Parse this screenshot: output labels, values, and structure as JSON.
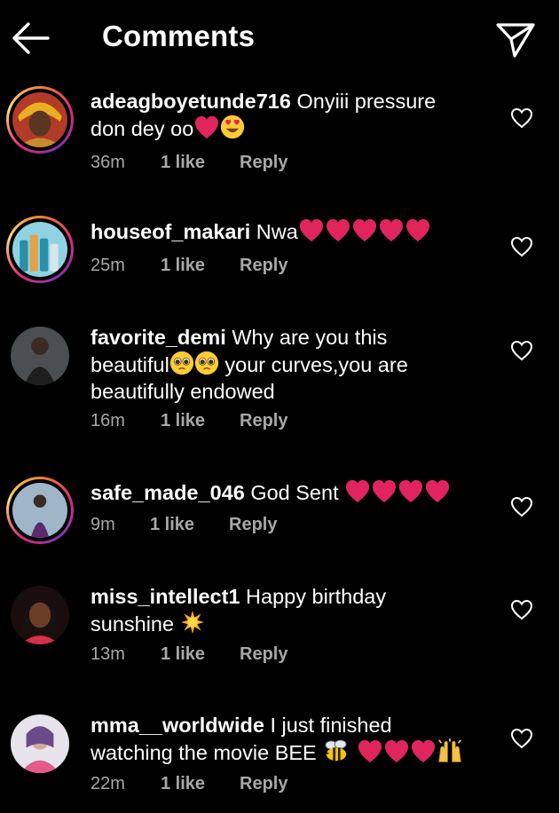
{
  "header": {
    "title": "Comments",
    "back_icon": "arrow-left-icon",
    "share_icon": "paper-plane-icon"
  },
  "colors": {
    "background": "#000000",
    "text": "#ffffff",
    "muted": "#a8a8a8",
    "heart": "#e0245e"
  },
  "comments": [
    {
      "username": "adeagboyetunde716",
      "line1": "Onyiii pressure",
      "line2": "don dey oo",
      "time": "36m",
      "likes": "1 like",
      "reply": "Reply",
      "emojis": [
        "red-heart",
        "heart-eyes"
      ],
      "story_ring": true
    },
    {
      "username": "houseof_makari",
      "line1": "Nwa",
      "time": "25m",
      "likes": "1 like",
      "reply": "Reply",
      "emojis": [
        "red-heart",
        "red-heart",
        "red-heart",
        "red-heart",
        "red-heart"
      ],
      "story_ring": true
    },
    {
      "username": "favorite_demi",
      "line1": "Why are you this",
      "line2a": "beautiful",
      "line2b": "your curves,you are",
      "line3": "beautifully endowed",
      "time": "16m",
      "likes": "1 like",
      "reply": "Reply",
      "emojis": [
        "pleading-face",
        "pleading-face"
      ],
      "story_ring": false
    },
    {
      "username": "safe_made_046",
      "line1": "God Sent",
      "time": "9m",
      "likes": "1 like",
      "reply": "Reply",
      "emojis": [
        "red-heart",
        "red-heart",
        "red-heart",
        "red-heart"
      ],
      "story_ring": true
    },
    {
      "username": "miss_intellect1",
      "line1": "Happy birthday",
      "line2": "sunshine",
      "time": "13m",
      "likes": "1 like",
      "reply": "Reply",
      "emojis": [
        "sun"
      ],
      "story_ring": false
    },
    {
      "username": "mma__worldwide",
      "line1": "I just finished",
      "line2": "watching the movie BEE",
      "time": "22m",
      "likes": "1 like",
      "reply": "Reply",
      "emojis": [
        "bee",
        "red-heart",
        "red-heart",
        "red-heart",
        "raised-hands"
      ],
      "story_ring": false
    }
  ]
}
